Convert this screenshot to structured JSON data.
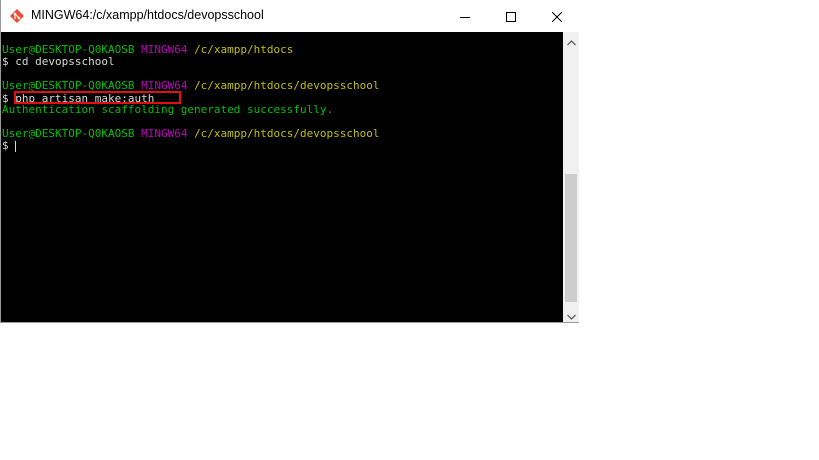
{
  "window": {
    "title": "MINGW64:/c/xampp/htdocs/devopsschool"
  },
  "terminal": {
    "lines": [
      {
        "user": "User@DESKTOP-Q0KAOSB",
        "shell": "MINGW64",
        "path": "/c/xampp/htdocs"
      },
      {
        "prompt": "$",
        "command": "cd devopsschool"
      },
      {
        "user": "User@DESKTOP-Q0KAOSB",
        "shell": "MINGW64",
        "path": "/c/xampp/htdocs/devopsschool"
      },
      {
        "prompt": "$",
        "command": "php artisan make:auth"
      },
      {
        "output": "Authentication scaffolding generated successfully."
      },
      {
        "user": "User@DESKTOP-Q0KAOSB",
        "shell": "MINGW64",
        "path": "/c/xampp/htdocs/devopsschool"
      },
      {
        "prompt": "$",
        "command": ""
      }
    ]
  },
  "colors": {
    "user": "#00c000",
    "shell": "#c000c0",
    "path": "#c0c000",
    "text": "#d8d8d8",
    "highlight": "#e01010"
  },
  "icons": {
    "app": "git-bash-icon",
    "minimize": "minimize-icon",
    "maximize": "maximize-icon",
    "close": "close-icon",
    "scroll_up": "chevron-up-icon",
    "scroll_down": "chevron-down-icon"
  }
}
